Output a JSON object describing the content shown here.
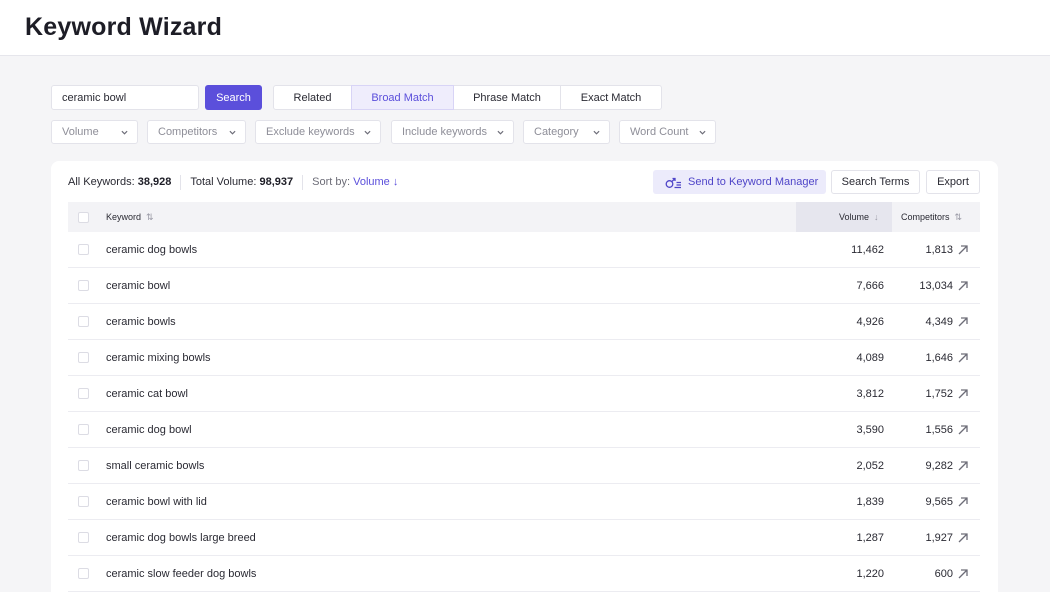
{
  "page": {
    "title": "Keyword Wizard"
  },
  "search": {
    "value": "ceramic bowl",
    "button_label": "Search"
  },
  "match_tabs": [
    {
      "label": "Related"
    },
    {
      "label": "Broad Match",
      "active": true
    },
    {
      "label": "Phrase Match"
    },
    {
      "label": "Exact Match"
    }
  ],
  "filters": [
    {
      "label": "Volume"
    },
    {
      "label": "Competitors"
    },
    {
      "label": "Exclude keywords"
    },
    {
      "label": "Include keywords"
    },
    {
      "label": "Category"
    },
    {
      "label": "Word Count"
    }
  ],
  "summary": {
    "all_keywords_label": "All Keywords:",
    "all_keywords_value": "38,928",
    "total_volume_label": "Total Volume:",
    "total_volume_value": "98,937",
    "sort_by_label": "Sort by:",
    "sort_by_value": "Volume ↓"
  },
  "actions": {
    "send_label": "Send to Keyword Manager",
    "search_terms_label": "Search Terms",
    "export_label": "Export"
  },
  "table": {
    "headers": {
      "keyword": "Keyword",
      "volume": "Volume",
      "competitors": "Competitors"
    },
    "sort_icons": {
      "keyword": "⇅",
      "volume": "↓",
      "competitors": "⇅"
    },
    "rows": [
      {
        "keyword": "ceramic dog bowls",
        "volume": "11,462",
        "competitors": "1,813"
      },
      {
        "keyword": "ceramic bowl",
        "volume": "7,666",
        "competitors": "13,034"
      },
      {
        "keyword": "ceramic bowls",
        "volume": "4,926",
        "competitors": "4,349"
      },
      {
        "keyword": "ceramic mixing bowls",
        "volume": "4,089",
        "competitors": "1,646"
      },
      {
        "keyword": "ceramic cat bowl",
        "volume": "3,812",
        "competitors": "1,752"
      },
      {
        "keyword": "ceramic dog bowl",
        "volume": "3,590",
        "competitors": "1,556"
      },
      {
        "keyword": "small ceramic bowls",
        "volume": "2,052",
        "competitors": "9,282"
      },
      {
        "keyword": "ceramic bowl with lid",
        "volume": "1,839",
        "competitors": "9,565"
      },
      {
        "keyword": "ceramic dog bowls large breed",
        "volume": "1,287",
        "competitors": "1,927"
      },
      {
        "keyword": "ceramic slow feeder dog bowls",
        "volume": "1,220",
        "competitors": "600"
      }
    ]
  },
  "colors": {
    "accent": "#5b4fdb",
    "accent_light": "#ecebfb",
    "background": "#f5f5f7"
  },
  "icons": {
    "send": "send-to-manager-icon",
    "row_link": "external-arrow-icon",
    "dropdown": "chevron-down-icon"
  }
}
